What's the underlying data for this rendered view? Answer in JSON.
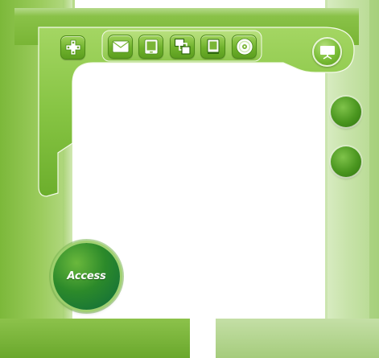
{
  "toolbar": {
    "icons": [
      "dpad-icon",
      "mail-icon",
      "tablet-icon",
      "windows-icon",
      "book-icon",
      "disc-icon",
      "screen-icon"
    ]
  },
  "side_buttons": [
    "round-button-1",
    "round-button-2"
  ],
  "access": {
    "label": "Access"
  },
  "colors": {
    "primary_green": "#7ab536",
    "dark_green": "#4a961f",
    "light_green": "#c2e0a0"
  }
}
